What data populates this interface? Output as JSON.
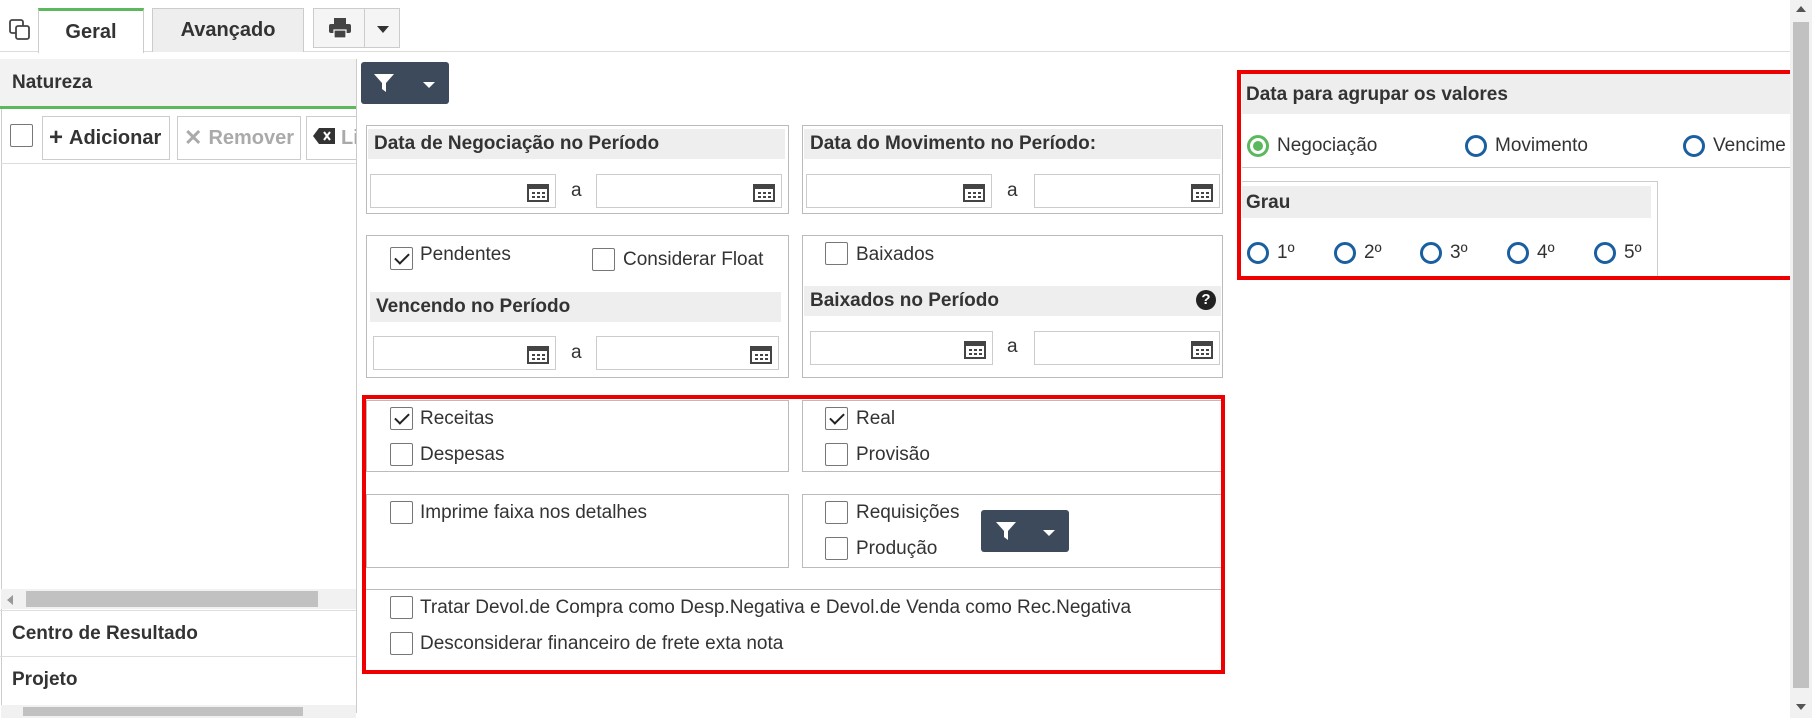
{
  "tabs": {
    "geral": "Geral",
    "avancado": "Avançado"
  },
  "sidebar": {
    "natureza": "Natureza",
    "adicionar": "Adicionar",
    "remover": "Remover",
    "limpar": "Li",
    "centro": "Centro de Resultado",
    "projeto": "Projeto"
  },
  "negociacao": {
    "title": "Data de Negociação no Período",
    "sep": "a"
  },
  "movimento": {
    "title": "Data do Movimento no Período:",
    "sep": "a"
  },
  "pendentes": {
    "label": "Pendentes",
    "checked": true,
    "float_label": "Considerar Float",
    "vencendo": "Vencendo no Período",
    "sep": "a"
  },
  "baixados": {
    "label": "Baixados",
    "periodo": "Baixados no Período",
    "sep": "a"
  },
  "tipo": {
    "receitas": "Receitas",
    "despesas": "Despesas",
    "real": "Real",
    "provisao": "Provisão",
    "faixa": "Imprime faixa nos detalhes",
    "requisicoes": "Requisições",
    "producao": "Produção"
  },
  "extra": {
    "devol": "Tratar Devol.de Compra como Desp.Negativa e Devol.de Venda como Rec.Negativa",
    "frete": "Desconsiderar financeiro de frete exta nota"
  },
  "agrupar": {
    "title": "Data para agrupar os valores",
    "options": [
      "Negociação",
      "Movimento",
      "Vencime"
    ],
    "selected": "Negociação"
  },
  "grau": {
    "title": "Grau",
    "options": [
      "1º",
      "2º",
      "3º",
      "4º",
      "5º"
    ]
  },
  "colors": {
    "red_highlight": "#e00000",
    "dark_button": "#3d4a5c",
    "radio_selected": "#5cb85c",
    "radio_default": "#1a5fa0"
  }
}
